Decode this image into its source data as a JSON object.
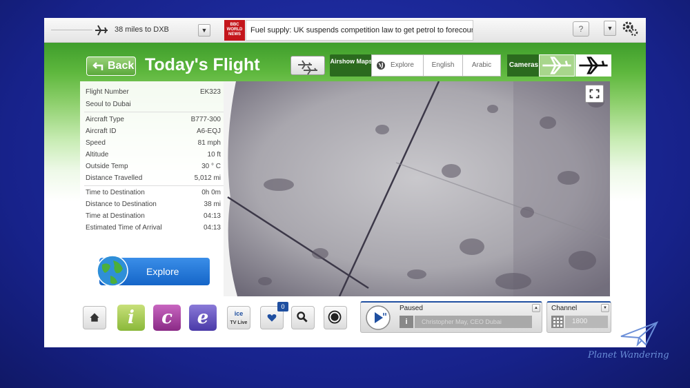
{
  "topbar": {
    "distance_text": "38  miles to DXB",
    "news_source": "BBC WORLD NEWS",
    "news_ticker": "Fuel supply: UK suspends competition law to get petrol to forecourts",
    "help_label": "?"
  },
  "header": {
    "back_label": "Back",
    "title": "Today's Flight",
    "airshow_label": "Airshow Maps",
    "tabs": [
      {
        "label": "Explore"
      },
      {
        "label": "English"
      },
      {
        "label": "Arabic"
      }
    ],
    "cameras_label": "Cameras"
  },
  "flight_info": {
    "number_label": "Flight Number",
    "number_value": "EK323",
    "route": "Seoul to Dubai",
    "rows": [
      {
        "label": "Aircraft Type",
        "value": "B777-300"
      },
      {
        "label": "Aircraft ID",
        "value": "A6-EQJ"
      },
      {
        "label": "Speed",
        "value": "81 mph"
      },
      {
        "label": "Altitude",
        "value": "10 ft"
      },
      {
        "label": "Outside Temp",
        "value": "30 ° C"
      },
      {
        "label": "Distance Travelled",
        "value": "5,012 mi"
      }
    ],
    "rows2": [
      {
        "label": "Time to Destination",
        "value": "0h 0m"
      },
      {
        "label": "Distance to Destination",
        "value": "38 mi"
      },
      {
        "label": "Time at Destination",
        "value": "04:13"
      },
      {
        "label": "Estimated Time of Arrival",
        "value": "04:13"
      }
    ],
    "explore_label": "Explore"
  },
  "dock": {
    "favorites_count": "0",
    "ice_label": "ice",
    "tvlive_label": "TV Live",
    "tile_i": "i",
    "tile_c": "c",
    "tile_e": "e"
  },
  "player": {
    "status": "Paused",
    "track": "Christopher May, CEO Dubai",
    "channel_label": "Channel",
    "channel_value": "1800"
  },
  "watermark": {
    "text": "Planet Wandering"
  },
  "colors": {
    "green_header": "#3f9e2c",
    "dark_green": "#2b6a1e",
    "accent_blue": "#1f4fa0",
    "bezel": "#1b2a8a"
  }
}
